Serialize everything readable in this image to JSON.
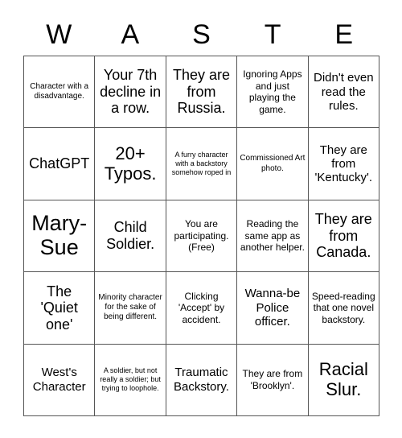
{
  "card": {
    "title_letters": [
      "W",
      "A",
      "S",
      "T",
      "E"
    ],
    "columns": 5,
    "rows": 5,
    "border_color": "#555555",
    "background_color": "#ffffff",
    "text_color": "#000000"
  },
  "cells": [
    {
      "text": "Character with a disadvantage.",
      "size": "s"
    },
    {
      "text": "Your 7th decline in a row.",
      "size": "xl"
    },
    {
      "text": "They are from Russia.",
      "size": "xl"
    },
    {
      "text": "Ignoring Apps and just playing the game.",
      "size": "m"
    },
    {
      "text": "Didn't even read the rules.",
      "size": "l"
    },
    {
      "text": "ChatGPT",
      "size": "xl"
    },
    {
      "text": "20+ Typos.",
      "size": "xxl"
    },
    {
      "text": "A furry character with a backstory somehow roped in",
      "size": "xs"
    },
    {
      "text": "Commissioned Art photo.",
      "size": "s"
    },
    {
      "text": "They are from 'Kentucky'.",
      "size": "l"
    },
    {
      "text": "Mary-Sue",
      "size": "3xl"
    },
    {
      "text": "Child Soldier.",
      "size": "xl"
    },
    {
      "text": "You are participating. (Free)",
      "size": "m"
    },
    {
      "text": "Reading the same app as another helper.",
      "size": "m"
    },
    {
      "text": "They are from Canada.",
      "size": "xl"
    },
    {
      "text": "The 'Quiet one'",
      "size": "xl"
    },
    {
      "text": "Minority character for the sake of being different.",
      "size": "s"
    },
    {
      "text": "Clicking 'Accept' by accident.",
      "size": "m"
    },
    {
      "text": "Wanna-be Police officer.",
      "size": "l"
    },
    {
      "text": "Speed-reading that one novel backstory.",
      "size": "m"
    },
    {
      "text": "West's Character",
      "size": "l"
    },
    {
      "text": "A soldier, but not really a soldier; but trying to loophole.",
      "size": "xs"
    },
    {
      "text": "Traumatic Backstory.",
      "size": "l"
    },
    {
      "text": "They are from 'Brooklyn'.",
      "size": "m"
    },
    {
      "text": "Racial Slur.",
      "size": "xxl"
    }
  ]
}
